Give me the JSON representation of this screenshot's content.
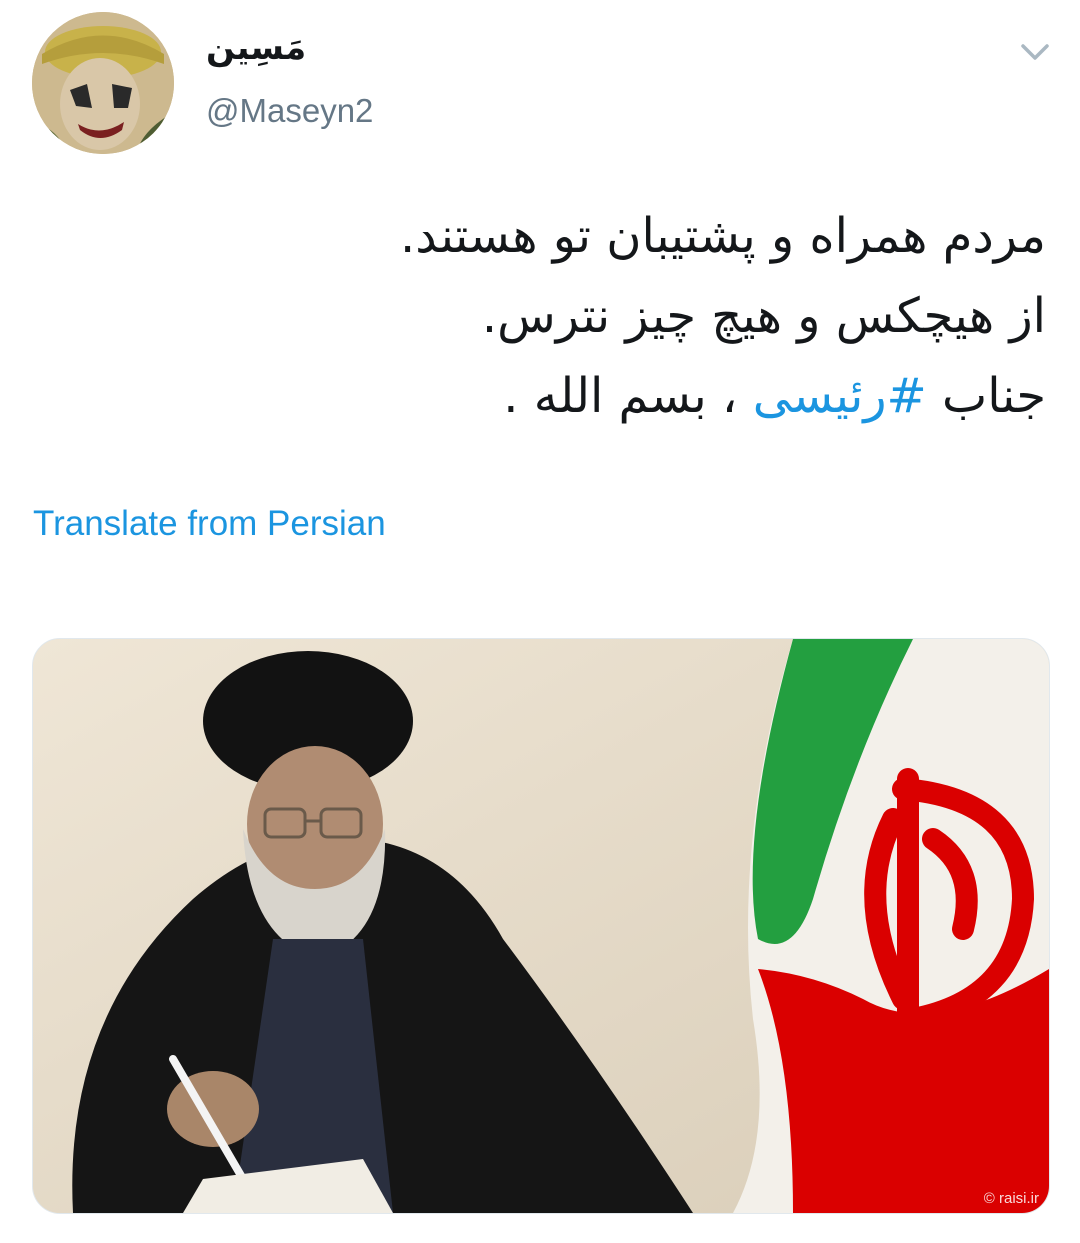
{
  "author": {
    "display_name": "مَسِین",
    "handle": "@Maseyn2"
  },
  "tweet": {
    "lines": [
      "مردم همراه و پشتیبان تو هستند.",
      "از هیچکس و هیچ چیز نترس."
    ],
    "line3_prefix": "جناب ",
    "hashtag": "#رئیسی",
    "line3_suffix": " ، بسم الله ."
  },
  "translate_label": "Translate from Persian",
  "media": {
    "watermark": "© raisi.ir"
  },
  "icons": {
    "caret": "chevron-down-icon"
  },
  "colors": {
    "link": "#1b95e0",
    "text": "#14171a",
    "secondary": "#657786",
    "flag_green": "#239f40",
    "flag_red": "#da0000"
  }
}
